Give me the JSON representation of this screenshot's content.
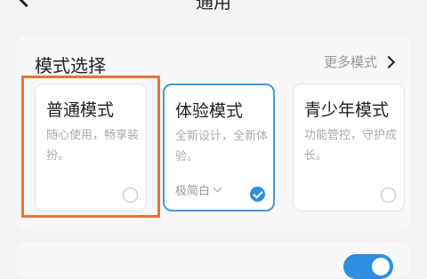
{
  "header": {
    "title": "通用"
  },
  "mode_section": {
    "title": "模式选择",
    "more_label": "更多模式",
    "cards": [
      {
        "name": "普通模式",
        "description": "随心使用，畅享装扮。",
        "selected": false
      },
      {
        "name": "体验模式",
        "description": "全新设计，全新体验。",
        "theme_label": "极简白",
        "selected": true
      },
      {
        "name": "青少年模式",
        "description": "功能管控，守护成长。",
        "selected": false
      }
    ]
  },
  "next_row": {
    "label": "",
    "toggle_on": true
  },
  "colors": {
    "accent": "#2f8ee0",
    "selected_border": "#3f9ad8",
    "highlight": "#e8723a"
  }
}
